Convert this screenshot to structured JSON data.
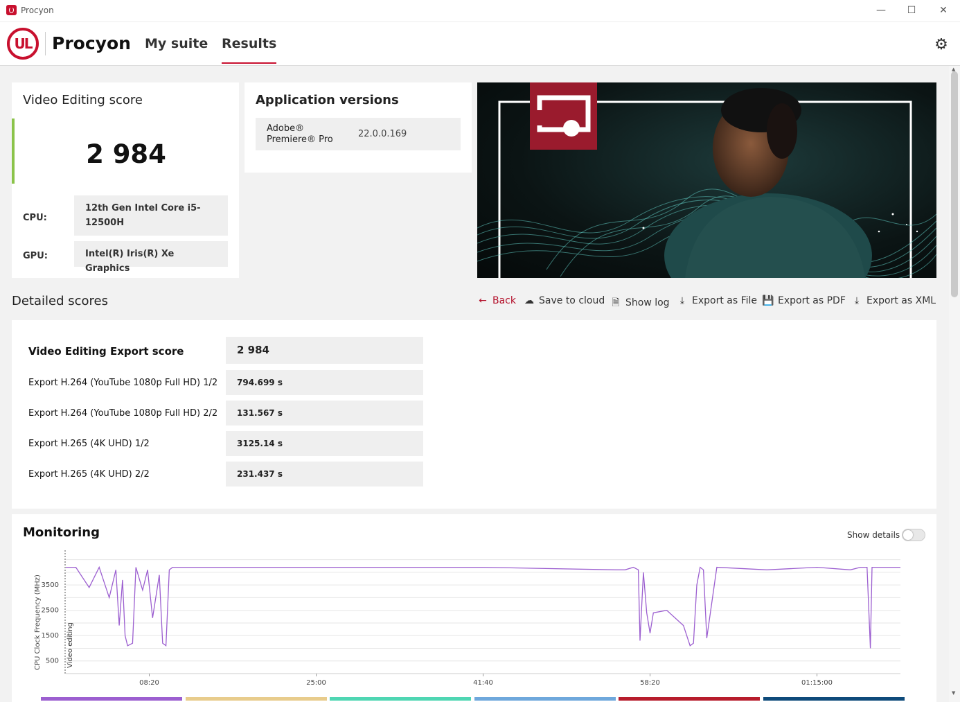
{
  "window": {
    "title": "Procyon"
  },
  "header": {
    "logo_text": "UL",
    "brand": "Procyon",
    "nav": [
      {
        "label": "My suite"
      },
      {
        "label": "Results",
        "active": true
      }
    ]
  },
  "score_card": {
    "title": "Video Editing score",
    "score": "2 984",
    "accent_color": "#8bc34a",
    "cpu_label": "CPU:",
    "cpu_value": "12th Gen Intel Core i5-12500H",
    "gpu_label": "GPU:",
    "gpu_value": "Intel(R) Iris(R) Xe Graphics"
  },
  "app_versions": {
    "title": "Application versions",
    "items": [
      {
        "name": "Adobe® Premiere® Pro",
        "version": "22.0.0.169"
      }
    ]
  },
  "detailed": {
    "title": "Detailed scores",
    "actions": {
      "back": "Back",
      "save_cloud": "Save to cloud",
      "show_log": "Show log",
      "export_file": "Export as File",
      "export_pdf": "Export as PDF",
      "export_xml": "Export as XML"
    },
    "main_label": "Video Editing Export score",
    "main_value": "2 984",
    "rows": [
      {
        "label": "Export H.264 (YouTube 1080p Full HD) 1/2",
        "value": "794.699 s"
      },
      {
        "label": "Export H.264 (YouTube 1080p Full HD) 2/2",
        "value": "131.567 s"
      },
      {
        "label": "Export H.265 (4K UHD) 1/2",
        "value": "3125.14 s"
      },
      {
        "label": "Export H.265 (4K UHD) 2/2",
        "value": "231.437 s"
      }
    ]
  },
  "monitoring": {
    "title": "Monitoring",
    "show_details_label": "Show details",
    "show_details_on": false,
    "chart_data": {
      "type": "line",
      "ylabel": "CPU Clock Frequency (MHz)",
      "marker_label": "Video editing",
      "y_ticks": [
        "500",
        "1500",
        "2500",
        "3500"
      ],
      "ylim": [
        0,
        4600
      ],
      "x_ticks": [
        "08:20",
        "25:00",
        "41:40",
        "58:20",
        "01:15:00"
      ],
      "x_tick_seconds": [
        500,
        1500,
        2500,
        3500,
        4500
      ],
      "xlim": [
        0,
        5000
      ],
      "line_color": "#9c5fd0",
      "grid": true,
      "series": [
        {
          "x": [
            0,
            60,
            140,
            200,
            260,
            300,
            320,
            340,
            355,
            370,
            400,
            420,
            460,
            490,
            520,
            560,
            580,
            600,
            620,
            640,
            680,
            1000,
            1500,
            2000,
            2500,
            3300,
            3350,
            3400,
            3430,
            3440,
            3460,
            3480,
            3500,
            3520,
            3600,
            3700,
            3740,
            3760,
            3780,
            3800,
            3820,
            3840,
            3900,
            4200,
            4500,
            4700,
            4760,
            4800,
            4820,
            4830,
            4850,
            5000
          ],
          "y": [
            4200,
            4200,
            3400,
            4200,
            3000,
            4100,
            1900,
            3700,
            1500,
            1100,
            1200,
            4200,
            3300,
            4100,
            2200,
            3900,
            1200,
            1100,
            4100,
            4200,
            4200,
            4200,
            4200,
            4200,
            4200,
            4100,
            4100,
            4200,
            4100,
            1300,
            4000,
            2400,
            1600,
            2400,
            2500,
            1900,
            1100,
            1200,
            3500,
            4200,
            4100,
            1400,
            4200,
            4100,
            4200,
            4100,
            4200,
            4200,
            1000,
            4200,
            4200,
            4200
          ]
        }
      ]
    },
    "legend_colors": [
      "#9c5fd0",
      "#e8cc8c",
      "#4fd6b3",
      "#6fa8dc",
      "#b71c2c",
      "#0e4a7a"
    ]
  }
}
